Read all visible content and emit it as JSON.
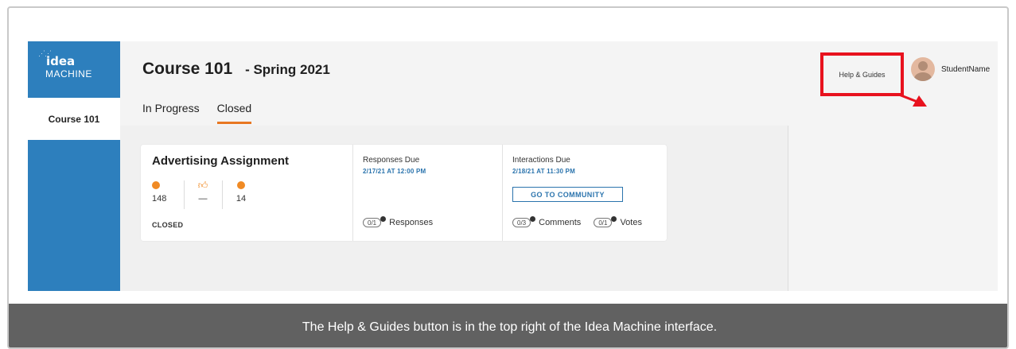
{
  "logo": {
    "line1": "idea",
    "line2": "MACHINE",
    "dots": "⋰⋰"
  },
  "sidebar": {
    "course_item": "Course 101"
  },
  "header": {
    "title": "Course 101",
    "subtitle": "- Spring 2021",
    "tabs": [
      {
        "label": "In Progress",
        "active": false
      },
      {
        "label": "Closed",
        "active": true
      }
    ],
    "help_link": "Help & Guides",
    "username": "StudentName"
  },
  "assignment": {
    "title": "Advertising Assignment",
    "stats": [
      {
        "icon": "comment-icon",
        "value": "148"
      },
      {
        "icon": "thumbs-up-icon",
        "value": "—"
      },
      {
        "icon": "smiley-icon",
        "value": "14"
      }
    ],
    "status": "CLOSED",
    "responses_due_label": "Responses Due",
    "responses_due_date": "2/17/21 AT 12:00 PM",
    "responses_pill": "0/1",
    "responses_label": "Responses",
    "interactions_due_label": "Interactions Due",
    "interactions_due_date": "2/18/21 AT 11:30 PM",
    "community_button": "GO TO COMMUNITY",
    "comments_pill": "0/3",
    "comments_label": "Comments",
    "votes_pill": "0/1",
    "votes_label": "Votes"
  },
  "caption": "The Help & Guides button is in the top right of the Idea Machine interface.",
  "colors": {
    "brand_blue": "#2d7fbd",
    "accent_orange": "#e87722",
    "highlight_red": "#e8121e",
    "link_blue": "#2b74ad",
    "caption_bg": "#616161"
  }
}
